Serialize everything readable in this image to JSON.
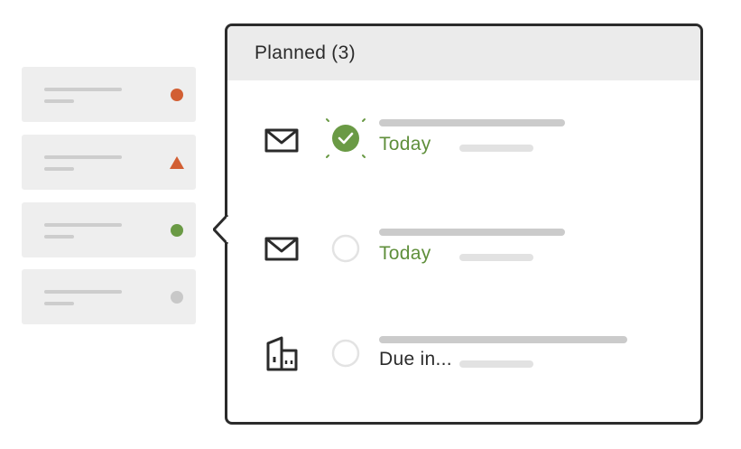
{
  "list": {
    "cards": [
      {
        "marker": "circle",
        "color": "#d25f33"
      },
      {
        "marker": "triangle",
        "color": "#d25f33"
      },
      {
        "marker": "circle",
        "color": "#6a9a45"
      },
      {
        "marker": "circle",
        "color": "#c8c8c8"
      }
    ]
  },
  "panel": {
    "title": "Planned (3)",
    "items": [
      {
        "icon": "mail-icon",
        "status": "completed",
        "due": "Today",
        "due_color": "#5f8f3b"
      },
      {
        "icon": "mail-icon",
        "status": "open",
        "due": "Today",
        "due_color": "#5f8f3b"
      },
      {
        "icon": "building-icon",
        "status": "open",
        "due": "Due in...",
        "due_color": "#2b2b2b"
      }
    ]
  },
  "colors": {
    "accent_green": "#6a9a45",
    "accent_orange": "#d25f33",
    "frame": "#2b2b2b"
  }
}
